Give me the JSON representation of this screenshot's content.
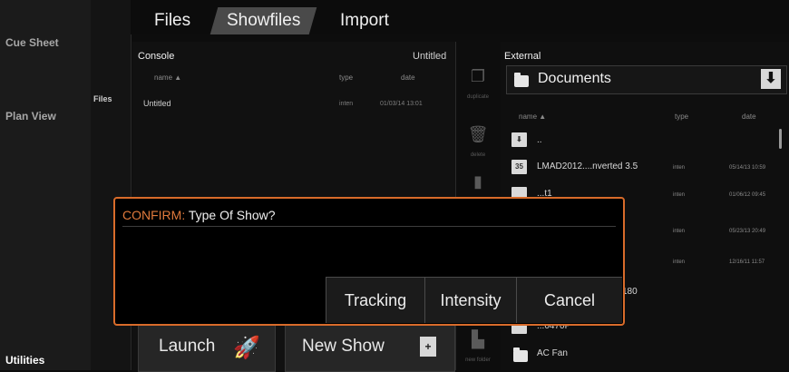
{
  "left_nav": {
    "items": [
      {
        "label": "Cue Sheet"
      },
      {
        "label": "Plan View"
      },
      {
        "label": "Utilities"
      }
    ]
  },
  "sub_nav": {
    "label": "Files"
  },
  "tabs": [
    {
      "label": "Files",
      "active": false
    },
    {
      "label": "Showfiles",
      "active": true
    },
    {
      "label": "Import",
      "active": false
    }
  ],
  "console": {
    "title": "Console",
    "show_name": "Untitled",
    "columns": {
      "name": "name ▲",
      "type": "type",
      "date": "date"
    },
    "rows": [
      {
        "name": "Untitled",
        "type": "inten",
        "date": "01/03/14 13:01"
      }
    ]
  },
  "tools": {
    "duplicate": "duplicate",
    "delete": "delete",
    "new_folder": "new folder"
  },
  "external": {
    "title": "External",
    "location": "Documents",
    "columns": {
      "name": "name ▲",
      "type": "type",
      "date": "date"
    },
    "rows": [
      {
        "name": "..",
        "type": "",
        "date": ""
      },
      {
        "name": "LMAD2012....nverted 3.5",
        "type": "inten",
        "date": "05/14/13 10:59"
      },
      {
        "name": "...t1",
        "type": "inten",
        "date": "01/06/12 09:45"
      },
      {
        "name": "",
        "type": "inten",
        "date": "05/23/13 20:49"
      },
      {
        "name": "",
        "type": "inten",
        "date": "12/16/11 11:57"
      },
      {
        "name": "180",
        "type": "",
        "date": ""
      },
      {
        "name": "...0470P",
        "type": "",
        "date": ""
      },
      {
        "name": "AC Fan",
        "type": "",
        "date": ""
      }
    ]
  },
  "bottom": {
    "launch": "Launch",
    "new_show": "New Show"
  },
  "dialog": {
    "keyword": "CONFIRM:",
    "question": "Type Of Show?",
    "buttons": [
      "Tracking",
      "Intensity",
      "Cancel"
    ]
  },
  "colors": {
    "accent": "#d86b2a",
    "panel": "#111111"
  }
}
